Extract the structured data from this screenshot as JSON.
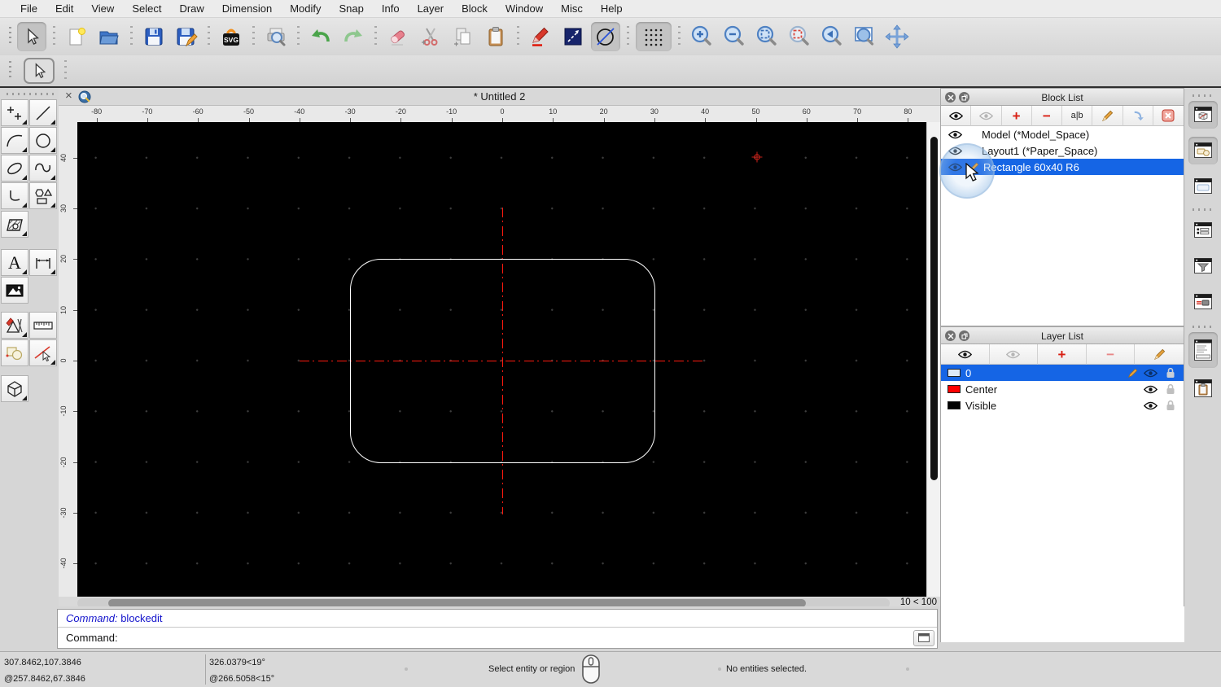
{
  "menu_bar": {
    "items": [
      "File",
      "Edit",
      "View",
      "Select",
      "Draw",
      "Dimension",
      "Modify",
      "Snap",
      "Info",
      "Layer",
      "Block",
      "Window",
      "Misc",
      "Help"
    ]
  },
  "toolbar": {
    "svg_label": "SVG",
    "icons": [
      "selection-pointer",
      "new-document",
      "open-document",
      "save",
      "save-as",
      "svg-export",
      "print-preview",
      "undo",
      "redo",
      "erase",
      "cut",
      "copy",
      "paste",
      "edit-attributes",
      "line-properties",
      "draft-mode",
      "grid-toggle",
      "zoom-in",
      "zoom-out",
      "auto-zoom",
      "zoom-selection",
      "previous-view",
      "window-zoom",
      "pan-zoom"
    ]
  },
  "left_palette": {
    "text_tool_glyph": "A",
    "icons": [
      "points",
      "line",
      "arc",
      "circle",
      "ellipse",
      "spline",
      "polyline",
      "shape",
      "hatch",
      "text",
      "dimension",
      "image",
      "modify",
      "measure",
      "selection",
      "snap",
      "solid"
    ]
  },
  "document_tab": {
    "close_glyph": "×",
    "title": "* Untitled 2"
  },
  "rulers": {
    "horizontal_labels": [
      "-80",
      "-70",
      "-60",
      "-50",
      "-40",
      "-30",
      "-20",
      "-10",
      "0",
      "10",
      "20",
      "30",
      "40",
      "50",
      "60",
      "70",
      "80"
    ],
    "vertical_labels": [
      "40",
      "30",
      "20",
      "10",
      "0",
      "-10",
      "-20",
      "-30",
      "-40"
    ]
  },
  "canvas": {
    "background": "#000000",
    "drawing": {
      "shape": "rounded-rectangle",
      "width_units": 60,
      "height_units": 40,
      "corner_radius_units": 6,
      "outline_color": "#ffffff",
      "centerline_color": "#ff1a0f",
      "grid_spacing_units": 10
    }
  },
  "scrollbar": {
    "grid_status": "10 < 100"
  },
  "glyphs": {
    "plus": "+",
    "minus": "−"
  },
  "block_list": {
    "title": "Block List",
    "rename_glyph": "a|b",
    "toolbar_icons": [
      "show-all-blocks",
      "hide-all-blocks",
      "add-block",
      "remove-block",
      "rename-block",
      "edit-block",
      "insert-block",
      "remove-all-blocks"
    ],
    "items": [
      {
        "name": "Model (*Model_Space)",
        "selected": false
      },
      {
        "name": "Layout1 (*Paper_Space)",
        "selected": false
      },
      {
        "name": "Rectangle 60x40 R6",
        "selected": true
      }
    ]
  },
  "layer_list": {
    "title": "Layer List",
    "toolbar_icons": [
      "show-all-layers",
      "hide-all-layers",
      "add-layer",
      "remove-layer",
      "edit-layer"
    ],
    "layers": [
      {
        "name": "0",
        "color": "#dce9f7",
        "selected": true
      },
      {
        "name": "Center",
        "color": "#ff0000",
        "selected": false
      },
      {
        "name": "Visible",
        "color": "#000000",
        "selected": false
      }
    ]
  },
  "right_toolbar": {
    "icons": [
      "block-list-panel",
      "layer-list-panel",
      "library-browser-panel",
      "property-editor-panel",
      "selection-filter-panel",
      "pointer-panel",
      "command-line-panel",
      "clipboard-panel"
    ]
  },
  "command_panel": {
    "history_label": "Command:",
    "history_command": "blockedit",
    "prompt_label": "Command:",
    "input_value": ""
  },
  "status_bar": {
    "absolute_cartesian": "307.8462,107.3846",
    "relative_cartesian": "@257.8462,67.3846",
    "absolute_polar": "326.0379<19°",
    "relative_polar": "@266.5058<15°",
    "action_hint": "Select entity or region",
    "selection_info": "No entities selected."
  }
}
